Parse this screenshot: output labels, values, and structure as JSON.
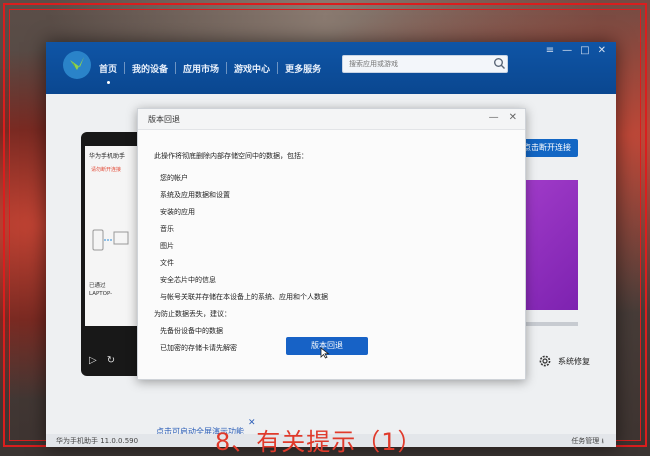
{
  "app": {
    "nav": [
      "首页",
      "我的设备",
      "应用市场",
      "游戏中心",
      "更多服务"
    ],
    "search_placeholder": "搜索应用或游戏",
    "window_controls": [
      "≡",
      "—",
      "□",
      "✕"
    ],
    "connect_button": "点击断开连接",
    "system_repair": "系统修复",
    "status_version": "华为手机助手 11.0.0.590",
    "status_task": "任务管理 ⭳"
  },
  "phone": {
    "header": "华为手机助手",
    "warning": "请勿断开连接",
    "connected_line1": "已通过",
    "connected_line2": "LAPTOP-"
  },
  "tip": {
    "text": "点击可启动全屏演示功能",
    "close": "✕"
  },
  "dialog": {
    "title": "版本回退",
    "controls": [
      "—",
      "✕"
    ],
    "intro": "此操作将彻底删除内部存储空间中的数据，包括：",
    "items": [
      "您的帐户",
      "系统及应用数据和设置",
      "安装的应用",
      "音乐",
      "图片",
      "文件",
      "安全芯片中的信息",
      "与帐号关联并存储在本设备上的系统、应用和个人数据"
    ],
    "advice_title": "为防止数据丢失，建议：",
    "advice_items": [
      "先备份设备中的数据",
      "已加密的存储卡请先解密"
    ],
    "button": "版本回退"
  },
  "caption": "8、有关提示（1）",
  "colors": {
    "frame": "#d91e1e",
    "titlebar": "#0f55a6",
    "primary_button": "#1762c6",
    "caption": "#e03a2b"
  }
}
